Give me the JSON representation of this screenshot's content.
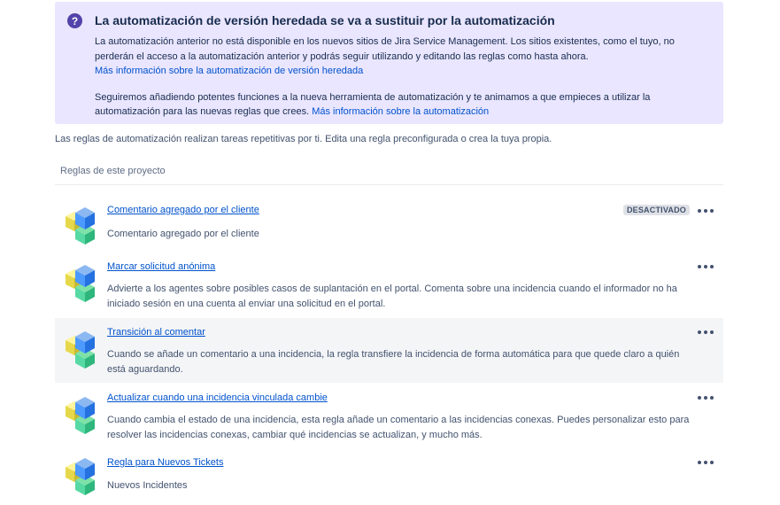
{
  "banner": {
    "title": "La automatización de versión heredada se va a sustituir por la automatización",
    "paragraph1": "La automatización anterior no está disponible en los nuevos sitios de Jira Service Management. Los sitios existentes, como el tuyo, no perderán el acceso a la automatización anterior y podrás seguir utilizando y editando las reglas como hasta ahora.",
    "link1": "Más información sobre la automatización de versión heredada",
    "paragraph2": "Seguiremos añadiendo potentes funciones a la nueva herramienta de automatización y te animamos a que empieces a utilizar la automatización para las nuevas reglas que crees.",
    "link2": "Más información sobre la automatización",
    "colors": {
      "background": "#EAE6FF",
      "icon": "#5243AA"
    }
  },
  "intro": "Las reglas de automatización realizan tareas repetitivas por ti. Edita una regla preconfigurada o crea la tuya propia.",
  "section_title": "Reglas de este proyecto",
  "rules": [
    {
      "name": "Comentario agregado por el cliente",
      "description": "Comentario agregado por el cliente",
      "badge": "DESACTIVADO",
      "icon": "cubes-icon",
      "more": "more-actions-icon"
    },
    {
      "name": "Marcar solicitud anónima",
      "description": "Advierte a los agentes sobre posibles casos de suplantación en el portal. Comenta sobre una incidencia cuando el informador no ha iniciado sesión en una cuenta al enviar una solicitud en el portal.",
      "badge": "",
      "icon": "cubes-icon",
      "more": "more-actions-icon"
    },
    {
      "name": "Transición al comentar",
      "description": "Cuando se añade un comentario a una incidencia, la regla transfiere la incidencia de forma automática para que quede claro a quién está aguardando.",
      "badge": "",
      "icon": "cubes-icon",
      "more": "more-actions-icon",
      "highlighted": true
    },
    {
      "name": "Actualizar cuando una incidencia vinculada cambie",
      "description": "Cuando cambia el estado de una incidencia, esta regla añade un comentario a las incidencias conexas. Puedes personalizar esto para resolver las incidencias conexas, cambiar qué incidencias se actualizan, y mucho más.",
      "badge": "",
      "icon": "cubes-icon",
      "more": "more-actions-icon"
    },
    {
      "name": "Regla para Nuevos Tickets",
      "description": "Nuevos Incidentes",
      "badge": "",
      "icon": "cubes-icon",
      "more": "more-actions-icon"
    }
  ]
}
